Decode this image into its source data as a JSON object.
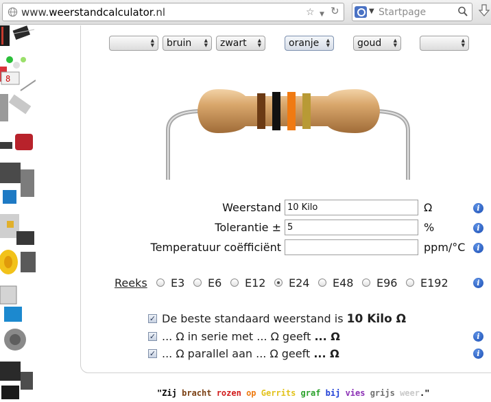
{
  "browser": {
    "url_prefix": "www.",
    "url_domain": "weerstandcalculator",
    "url_suffix": ".nl",
    "search_engine": "Startpage",
    "icons": [
      "globe-icon",
      "star-icon",
      "dropdown-icon",
      "reload-icon",
      "search-icon",
      "download-icon"
    ]
  },
  "bands": [
    {
      "value": "",
      "color": ""
    },
    {
      "value": "bruin",
      "color": "#6b3a14"
    },
    {
      "value": "zwart",
      "color": "#111111"
    },
    {
      "value": "oranje",
      "color": "#f07a12"
    },
    {
      "value": "goud",
      "color": "#b89a35"
    },
    {
      "value": "",
      "color": ""
    }
  ],
  "form": {
    "weerstand_label": "Weerstand",
    "weerstand_value": "10 Kilo",
    "weerstand_unit": "Ω",
    "tolerantie_label": "Tolerantie ±",
    "tolerantie_value": "5",
    "tolerantie_unit": "%",
    "temp_label": "Temperatuur coëfficiënt",
    "temp_value": "",
    "temp_unit": "ppm/°C"
  },
  "reeks": {
    "label": "Reeks",
    "options": [
      "E3",
      "E6",
      "E12",
      "E24",
      "E48",
      "E96",
      "E192"
    ],
    "selected": "E24"
  },
  "checks": {
    "best_prefix": "De beste standaard weerstand is",
    "best_value": "10 Kilo Ω",
    "serie_prefix": "... Ω in serie met ... Ω geeft",
    "serie_value": "... Ω",
    "parallel_prefix": "... Ω parallel aan ... Ω geeft",
    "parallel_value": "... Ω"
  },
  "quote": [
    {
      "text": "\"Zij ",
      "color": "#000000"
    },
    {
      "text": "bracht ",
      "color": "#7a3f12"
    },
    {
      "text": "rozen ",
      "color": "#d11a1a"
    },
    {
      "text": "op ",
      "color": "#ee7a10"
    },
    {
      "text": "Gerrits ",
      "color": "#e2c21a"
    },
    {
      "text": "graf ",
      "color": "#2aa12a"
    },
    {
      "text": "bij ",
      "color": "#1f3fd6"
    },
    {
      "text": "vies ",
      "color": "#8b2fb5"
    },
    {
      "text": "grijs ",
      "color": "#6f6f6f"
    },
    {
      "text": "weer",
      "color": "#c8c8c8"
    },
    {
      "text": ".\"",
      "color": "#000000"
    }
  ]
}
